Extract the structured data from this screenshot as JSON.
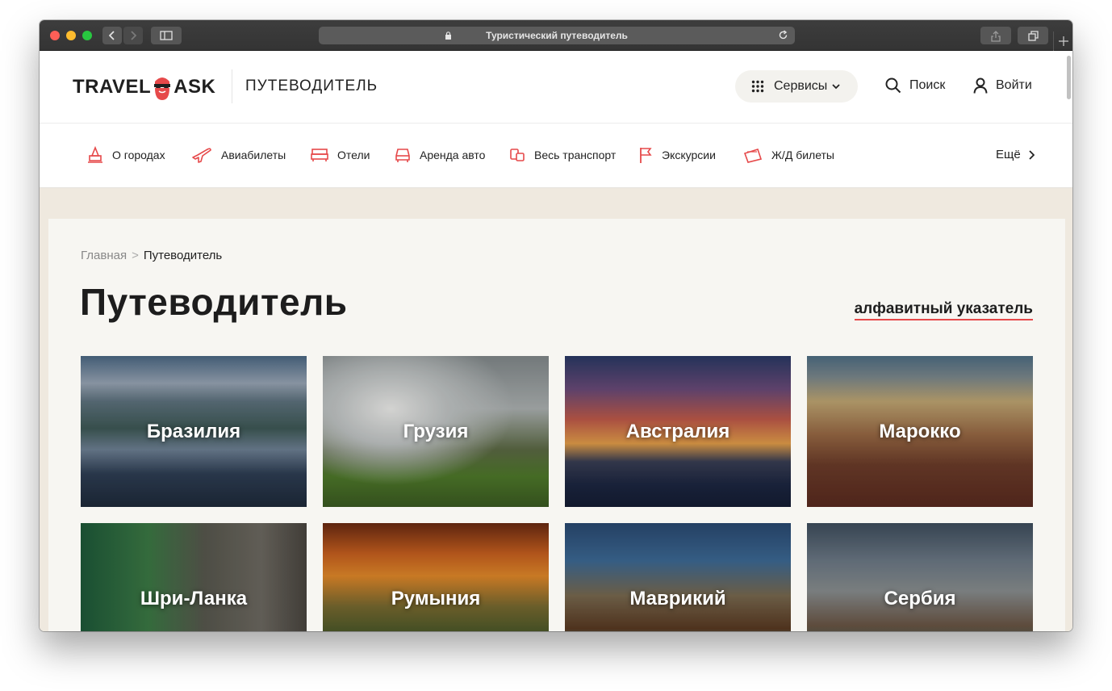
{
  "browser": {
    "page_title": "Туристический путеводитель"
  },
  "header": {
    "logo_left": "TRAVEL",
    "logo_right": "ASK",
    "section_label": "ПУТЕВОДИТЕЛЬ",
    "services_label": "Сервисы",
    "search_label": "Поиск",
    "login_label": "Войти"
  },
  "nav": {
    "items": [
      {
        "label": "О городах",
        "icon": "city-icon"
      },
      {
        "label": "Авиабилеты",
        "icon": "plane-icon"
      },
      {
        "label": "Отели",
        "icon": "bed-icon"
      },
      {
        "label": "Аренда авто",
        "icon": "car-icon"
      },
      {
        "label": "Весь транспорт",
        "icon": "transport-icon"
      },
      {
        "label": "Экскурсии",
        "icon": "flag-icon"
      },
      {
        "label": "Ж/Д билеты",
        "icon": "ticket-icon"
      }
    ],
    "more_label": "Ещё"
  },
  "breadcrumb": {
    "home": "Главная",
    "separator": ">",
    "current": "Путеводитель"
  },
  "page": {
    "title": "Путеводитель",
    "alpha_index_link": "алфавитный указатель"
  },
  "destinations": [
    {
      "name": "Бразилия"
    },
    {
      "name": "Грузия"
    },
    {
      "name": "Австралия"
    },
    {
      "name": "Марокко"
    },
    {
      "name": "Шри-Ланка"
    },
    {
      "name": "Румыния"
    },
    {
      "name": "Маврикий"
    },
    {
      "name": "Сербия"
    }
  ],
  "colors": {
    "accent": "#e6494a",
    "page_background": "#efe9df",
    "panel_background": "#f7f6f2",
    "text": "#1d1d1d"
  }
}
